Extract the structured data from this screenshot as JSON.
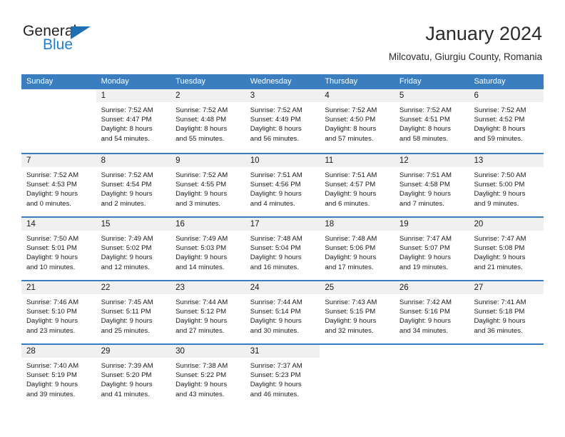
{
  "brand": {
    "name_top": "General",
    "name_bottom": "Blue",
    "triangle_icon": "triangle-icon",
    "accent_color": "#1f7fd0"
  },
  "header": {
    "title": "January 2024",
    "subtitle": "Milcovatu, Giurgiu County, Romania"
  },
  "calendar": {
    "header_bg": "#3a7ebf",
    "day_band_bg": "#f0f0f0",
    "weekdays": [
      "Sunday",
      "Monday",
      "Tuesday",
      "Wednesday",
      "Thursday",
      "Friday",
      "Saturday"
    ],
    "weeks": [
      [
        {
          "blank": true
        },
        {
          "day": "1",
          "sunrise": "Sunrise: 7:52 AM",
          "sunset": "Sunset: 4:47 PM",
          "daylight1": "Daylight: 8 hours",
          "daylight2": "and 54 minutes."
        },
        {
          "day": "2",
          "sunrise": "Sunrise: 7:52 AM",
          "sunset": "Sunset: 4:48 PM",
          "daylight1": "Daylight: 8 hours",
          "daylight2": "and 55 minutes."
        },
        {
          "day": "3",
          "sunrise": "Sunrise: 7:52 AM",
          "sunset": "Sunset: 4:49 PM",
          "daylight1": "Daylight: 8 hours",
          "daylight2": "and 56 minutes."
        },
        {
          "day": "4",
          "sunrise": "Sunrise: 7:52 AM",
          "sunset": "Sunset: 4:50 PM",
          "daylight1": "Daylight: 8 hours",
          "daylight2": "and 57 minutes."
        },
        {
          "day": "5",
          "sunrise": "Sunrise: 7:52 AM",
          "sunset": "Sunset: 4:51 PM",
          "daylight1": "Daylight: 8 hours",
          "daylight2": "and 58 minutes."
        },
        {
          "day": "6",
          "sunrise": "Sunrise: 7:52 AM",
          "sunset": "Sunset: 4:52 PM",
          "daylight1": "Daylight: 8 hours",
          "daylight2": "and 59 minutes."
        }
      ],
      [
        {
          "day": "7",
          "sunrise": "Sunrise: 7:52 AM",
          "sunset": "Sunset: 4:53 PM",
          "daylight1": "Daylight: 9 hours",
          "daylight2": "and 0 minutes."
        },
        {
          "day": "8",
          "sunrise": "Sunrise: 7:52 AM",
          "sunset": "Sunset: 4:54 PM",
          "daylight1": "Daylight: 9 hours",
          "daylight2": "and 2 minutes."
        },
        {
          "day": "9",
          "sunrise": "Sunrise: 7:52 AM",
          "sunset": "Sunset: 4:55 PM",
          "daylight1": "Daylight: 9 hours",
          "daylight2": "and 3 minutes."
        },
        {
          "day": "10",
          "sunrise": "Sunrise: 7:51 AM",
          "sunset": "Sunset: 4:56 PM",
          "daylight1": "Daylight: 9 hours",
          "daylight2": "and 4 minutes."
        },
        {
          "day": "11",
          "sunrise": "Sunrise: 7:51 AM",
          "sunset": "Sunset: 4:57 PM",
          "daylight1": "Daylight: 9 hours",
          "daylight2": "and 6 minutes."
        },
        {
          "day": "12",
          "sunrise": "Sunrise: 7:51 AM",
          "sunset": "Sunset: 4:58 PM",
          "daylight1": "Daylight: 9 hours",
          "daylight2": "and 7 minutes."
        },
        {
          "day": "13",
          "sunrise": "Sunrise: 7:50 AM",
          "sunset": "Sunset: 5:00 PM",
          "daylight1": "Daylight: 9 hours",
          "daylight2": "and 9 minutes."
        }
      ],
      [
        {
          "day": "14",
          "sunrise": "Sunrise: 7:50 AM",
          "sunset": "Sunset: 5:01 PM",
          "daylight1": "Daylight: 9 hours",
          "daylight2": "and 10 minutes."
        },
        {
          "day": "15",
          "sunrise": "Sunrise: 7:49 AM",
          "sunset": "Sunset: 5:02 PM",
          "daylight1": "Daylight: 9 hours",
          "daylight2": "and 12 minutes."
        },
        {
          "day": "16",
          "sunrise": "Sunrise: 7:49 AM",
          "sunset": "Sunset: 5:03 PM",
          "daylight1": "Daylight: 9 hours",
          "daylight2": "and 14 minutes."
        },
        {
          "day": "17",
          "sunrise": "Sunrise: 7:48 AM",
          "sunset": "Sunset: 5:04 PM",
          "daylight1": "Daylight: 9 hours",
          "daylight2": "and 16 minutes."
        },
        {
          "day": "18",
          "sunrise": "Sunrise: 7:48 AM",
          "sunset": "Sunset: 5:06 PM",
          "daylight1": "Daylight: 9 hours",
          "daylight2": "and 17 minutes."
        },
        {
          "day": "19",
          "sunrise": "Sunrise: 7:47 AM",
          "sunset": "Sunset: 5:07 PM",
          "daylight1": "Daylight: 9 hours",
          "daylight2": "and 19 minutes."
        },
        {
          "day": "20",
          "sunrise": "Sunrise: 7:47 AM",
          "sunset": "Sunset: 5:08 PM",
          "daylight1": "Daylight: 9 hours",
          "daylight2": "and 21 minutes."
        }
      ],
      [
        {
          "day": "21",
          "sunrise": "Sunrise: 7:46 AM",
          "sunset": "Sunset: 5:10 PM",
          "daylight1": "Daylight: 9 hours",
          "daylight2": "and 23 minutes."
        },
        {
          "day": "22",
          "sunrise": "Sunrise: 7:45 AM",
          "sunset": "Sunset: 5:11 PM",
          "daylight1": "Daylight: 9 hours",
          "daylight2": "and 25 minutes."
        },
        {
          "day": "23",
          "sunrise": "Sunrise: 7:44 AM",
          "sunset": "Sunset: 5:12 PM",
          "daylight1": "Daylight: 9 hours",
          "daylight2": "and 27 minutes."
        },
        {
          "day": "24",
          "sunrise": "Sunrise: 7:44 AM",
          "sunset": "Sunset: 5:14 PM",
          "daylight1": "Daylight: 9 hours",
          "daylight2": "and 30 minutes."
        },
        {
          "day": "25",
          "sunrise": "Sunrise: 7:43 AM",
          "sunset": "Sunset: 5:15 PM",
          "daylight1": "Daylight: 9 hours",
          "daylight2": "and 32 minutes."
        },
        {
          "day": "26",
          "sunrise": "Sunrise: 7:42 AM",
          "sunset": "Sunset: 5:16 PM",
          "daylight1": "Daylight: 9 hours",
          "daylight2": "and 34 minutes."
        },
        {
          "day": "27",
          "sunrise": "Sunrise: 7:41 AM",
          "sunset": "Sunset: 5:18 PM",
          "daylight1": "Daylight: 9 hours",
          "daylight2": "and 36 minutes."
        }
      ],
      [
        {
          "day": "28",
          "sunrise": "Sunrise: 7:40 AM",
          "sunset": "Sunset: 5:19 PM",
          "daylight1": "Daylight: 9 hours",
          "daylight2": "and 39 minutes."
        },
        {
          "day": "29",
          "sunrise": "Sunrise: 7:39 AM",
          "sunset": "Sunset: 5:20 PM",
          "daylight1": "Daylight: 9 hours",
          "daylight2": "and 41 minutes."
        },
        {
          "day": "30",
          "sunrise": "Sunrise: 7:38 AM",
          "sunset": "Sunset: 5:22 PM",
          "daylight1": "Daylight: 9 hours",
          "daylight2": "and 43 minutes."
        },
        {
          "day": "31",
          "sunrise": "Sunrise: 7:37 AM",
          "sunset": "Sunset: 5:23 PM",
          "daylight1": "Daylight: 9 hours",
          "daylight2": "and 46 minutes."
        },
        {
          "blank": true
        },
        {
          "blank": true
        },
        {
          "blank": true
        }
      ]
    ]
  }
}
